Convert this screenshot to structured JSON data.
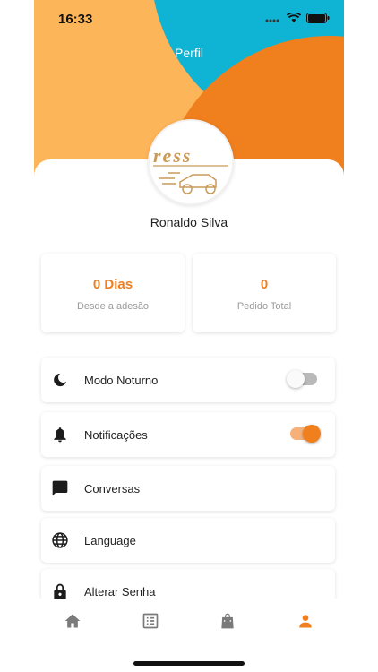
{
  "status_bar": {
    "time": "16:33"
  },
  "header": {
    "title": "Perfil"
  },
  "profile": {
    "name": "Ronaldo Silva",
    "avatar_text": "ress"
  },
  "stats": [
    {
      "value": "0 Dias",
      "label": "Desde a adesão"
    },
    {
      "value": "0",
      "label": "Pedido Total"
    }
  ],
  "menu": {
    "dark_mode": {
      "label": "Modo Noturno",
      "icon": "moon-icon",
      "enabled": false
    },
    "notifications": {
      "label": "Notificações",
      "icon": "bell-icon",
      "enabled": true
    },
    "chats": {
      "label": "Conversas",
      "icon": "chat-icon"
    },
    "language": {
      "label": "Language",
      "icon": "globe-icon"
    },
    "password": {
      "label": "Alterar Senha",
      "icon": "lock-icon"
    }
  },
  "tabbar": [
    {
      "icon": "home-icon",
      "active": false
    },
    {
      "icon": "orders-icon",
      "active": false
    },
    {
      "icon": "shopping-bag-icon",
      "active": false
    },
    {
      "icon": "profile-icon",
      "active": true
    }
  ],
  "colors": {
    "accent": "#f07f1e",
    "header_yellow": "#fdb55a",
    "header_blue": "#0fb3d4",
    "inactive_icon": "#7a7a7a"
  }
}
